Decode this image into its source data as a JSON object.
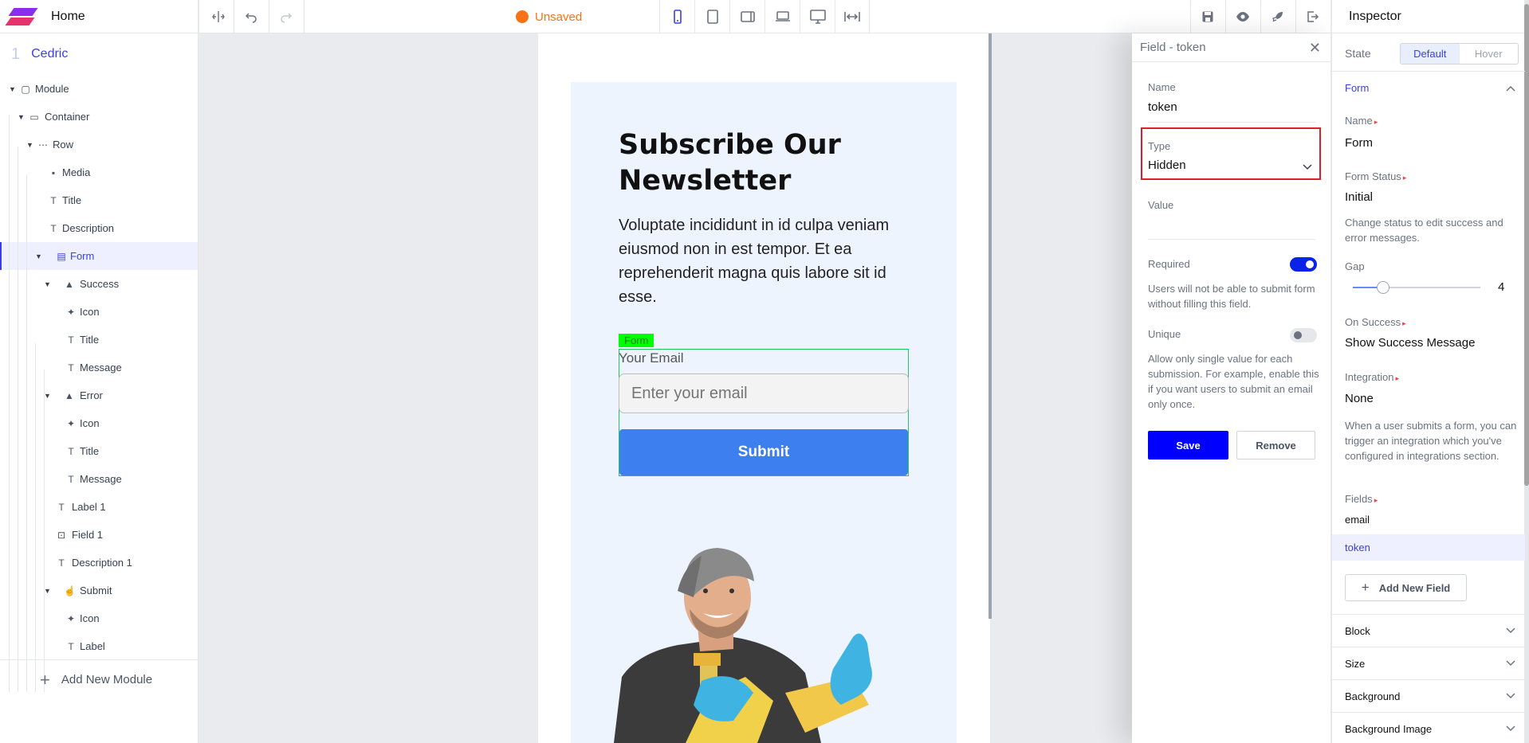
{
  "app": {
    "title": "Home"
  },
  "navigator": {
    "page_number": "1",
    "page_name": "Cedric",
    "tree": [
      {
        "label": "Module",
        "icon": "square-icon",
        "depth": 0,
        "caret": true
      },
      {
        "label": "Container",
        "icon": "monitor-icon",
        "depth": 1,
        "caret": true
      },
      {
        "label": "Row",
        "icon": "row-icon",
        "depth": 2,
        "caret": true
      },
      {
        "label": "Media",
        "icon": "image-icon",
        "depth": 3,
        "caret": false
      },
      {
        "label": "Title",
        "icon": "text-icon",
        "depth": 3,
        "caret": false
      },
      {
        "label": "Description",
        "icon": "text-icon",
        "depth": 3,
        "caret": false
      },
      {
        "label": "Form",
        "icon": "form-icon",
        "depth": 3,
        "caret": true,
        "selected": true
      },
      {
        "label": "Success",
        "icon": "warning-icon",
        "depth": 4,
        "caret": true
      },
      {
        "label": "Icon",
        "icon": "sparkle-icon",
        "depth": 5,
        "caret": false
      },
      {
        "label": "Title",
        "icon": "text-icon",
        "depth": 5,
        "caret": false
      },
      {
        "label": "Message",
        "icon": "text-icon",
        "depth": 5,
        "caret": false
      },
      {
        "label": "Error",
        "icon": "warning-icon",
        "depth": 4,
        "caret": true
      },
      {
        "label": "Icon",
        "icon": "sparkle-icon",
        "depth": 5,
        "caret": false
      },
      {
        "label": "Title",
        "icon": "text-icon",
        "depth": 5,
        "caret": false
      },
      {
        "label": "Message",
        "icon": "text-icon",
        "depth": 5,
        "caret": false
      },
      {
        "label": "Label 1",
        "icon": "text-icon",
        "depth": 4,
        "caret": false
      },
      {
        "label": "Field 1",
        "icon": "input-icon",
        "depth": 4,
        "caret": false
      },
      {
        "label": "Description 1",
        "icon": "text-icon",
        "depth": 4,
        "caret": false
      },
      {
        "label": "Submit",
        "icon": "click-icon",
        "depth": 4,
        "caret": true
      },
      {
        "label": "Icon",
        "icon": "sparkle-icon",
        "depth": 5,
        "caret": false
      },
      {
        "label": "Label",
        "icon": "text-icon",
        "depth": 5,
        "caret": false
      }
    ],
    "add_module_label": "Add New Module"
  },
  "toolbar": {
    "status": "Unsaved",
    "status_color": "#f97316",
    "devices": [
      "mobile-icon",
      "tablet-icon",
      "tablet-landscape-icon",
      "laptop-icon",
      "desktop-icon",
      "full-width-icon"
    ],
    "active_device": "mobile-icon"
  },
  "canvas": {
    "title": "Subscribe Our Newsletter",
    "description": "Voluptate incididunt in id culpa veniam eiusmod non in est tempor. Et ea reprehenderit magna quis labore sit id esse.",
    "form_tag": "Form",
    "email_label": "Your Email",
    "email_placeholder": "Enter your email",
    "submit_label": "Submit"
  },
  "field_panel": {
    "title": "Field - token",
    "name_label": "Name",
    "name_value": "token",
    "type_label": "Type",
    "type_value": "Hidden",
    "value_label": "Value",
    "value_value": "",
    "required_label": "Required",
    "required_on": true,
    "required_help": "Users will not be able to submit form without filling this field.",
    "unique_label": "Unique",
    "unique_on": false,
    "unique_help": "Allow only single value for each submission. For example, enable this if you want users to submit an email only once.",
    "save_label": "Save",
    "remove_label": "Remove"
  },
  "inspector": {
    "title": "Inspector",
    "state_label": "State",
    "state_options": [
      "Default",
      "Hover"
    ],
    "state_selected": "Default",
    "form_section": "Form",
    "name_label": "Name",
    "name_value": "Form",
    "form_status_label": "Form Status",
    "form_status_value": "Initial",
    "form_status_help": "Change status to edit success and error messages.",
    "gap_label": "Gap",
    "gap_value": "4",
    "gap_fraction": 0.24,
    "on_success_label": "On Success",
    "on_success_value": "Show Success Message",
    "integration_label": "Integration",
    "integration_value": "None",
    "integration_help": "When a user submits a form, you can trigger an integration which you've configured in integrations section.",
    "fields_label": "Fields",
    "fields": [
      "email",
      "token"
    ],
    "fields_selected": "token",
    "add_field_label": "Add New Field",
    "sections": [
      "Block",
      "Size",
      "Background",
      "Background Image"
    ]
  }
}
